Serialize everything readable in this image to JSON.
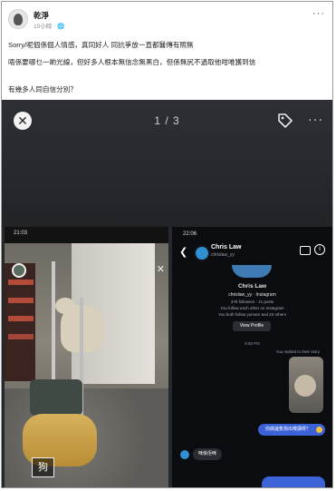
{
  "post": {
    "author": "乾淨",
    "time": "10小時 · 🌐",
    "more": "···",
    "text_line1": "Sorry/呢個係個人情感，真同好人 同抗爭放一直都醫傳有照無",
    "text_line2": "唔係要哪乜一啲光線，但好多人根本無信念無黑白，但係無尻不過取他咁唯獲到信",
    "text_line3": "有幾多人同自信分別？"
  },
  "viewer": {
    "close": "✕",
    "counter": "1 / 3",
    "more": "···"
  },
  "left_shot": {
    "time": "21:03",
    "label": "狗",
    "close_glyph": "✕"
  },
  "right_shot": {
    "time": "22:06",
    "back": "❮",
    "name": "Chris Law",
    "handle": "chrislaw_yy",
    "profile_name": "Chris Law",
    "profile_handle": "chrislaw_yy · Instagram",
    "followers": "378 followers · 11 posts",
    "line3": "You follow each other on Instagram",
    "line4": "You both follow yumam and 23 others",
    "view_profile": "View Profile",
    "date": "8:58 PM",
    "replied_note": "You replied to their story",
    "outgoing": "你搞邊隻狗出嚟講呀？",
    "incoming": "咪係佢咪",
    "info": "i"
  }
}
